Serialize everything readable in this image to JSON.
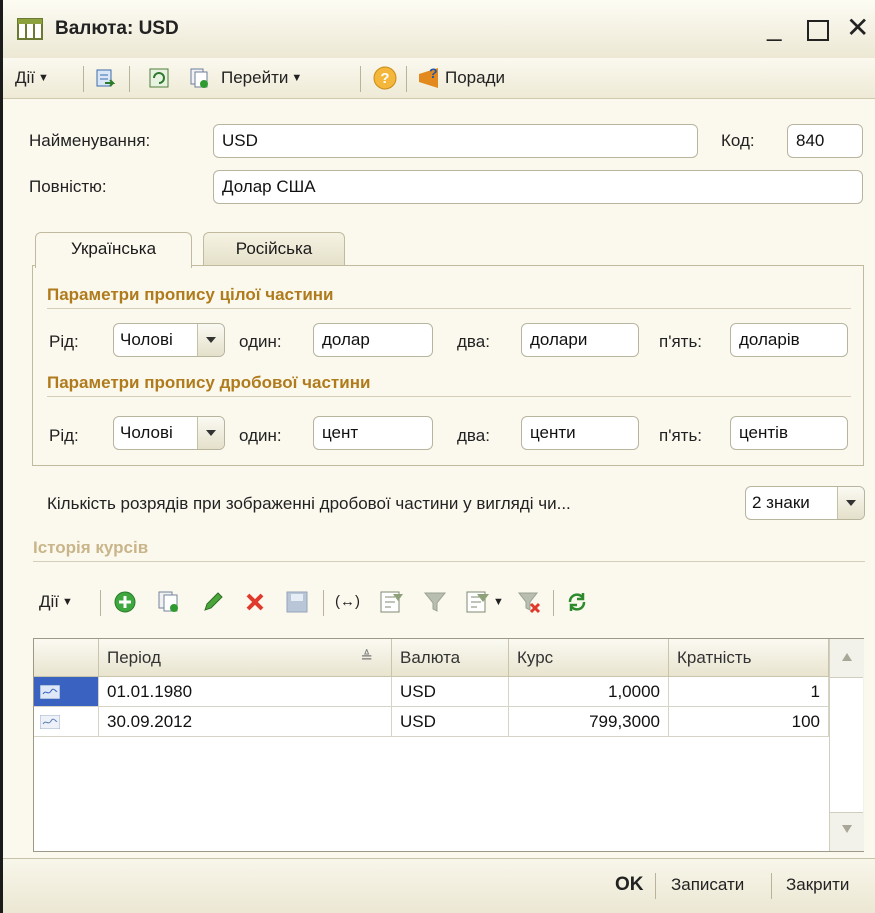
{
  "window": {
    "title": "Валюта: USD"
  },
  "toolbar": {
    "actions_label": "Дії",
    "goto_label": "Перейти",
    "tips_label": "Поради"
  },
  "form": {
    "name_label": "Найменування:",
    "name_value": "USD",
    "code_label": "Код:",
    "code_value": "840",
    "full_label": "Повністю:",
    "full_value": "Долар США"
  },
  "tabs": [
    "Українська",
    "Російська"
  ],
  "integer_part": {
    "title": "Параметри пропису цілої частини",
    "gender_label": "Рід:",
    "gender_value": "Чолові",
    "one_label": "один:",
    "one_value": "долар",
    "two_label": "два:",
    "two_value": "долари",
    "five_label": "п'ять:",
    "five_value": "доларів"
  },
  "fraction_part": {
    "title": "Параметри пропису дробової частини",
    "gender_label": "Рід:",
    "gender_value": "Чолові",
    "one_label": "один:",
    "one_value": "цент",
    "two_label": "два:",
    "two_value": "центи",
    "five_label": "п'ять:",
    "five_value": "центів"
  },
  "digits": {
    "label": "Кількість розрядів при зображенні дробової частини у вигляді чи...",
    "value": "2 знаки"
  },
  "history": {
    "title": "Історія курсів",
    "actions_label": "Дії",
    "columns": [
      "Період",
      "Валюта",
      "Курс",
      "Кратність"
    ],
    "rows": [
      {
        "period": "01.01.1980",
        "currency": "USD",
        "rate": "1,0000",
        "multiplicity": "1"
      },
      {
        "period": "30.09.2012",
        "currency": "USD",
        "rate": "799,3000",
        "multiplicity": "100"
      }
    ]
  },
  "footer": {
    "ok": "OK",
    "save": "Записати",
    "close": "Закрити"
  }
}
